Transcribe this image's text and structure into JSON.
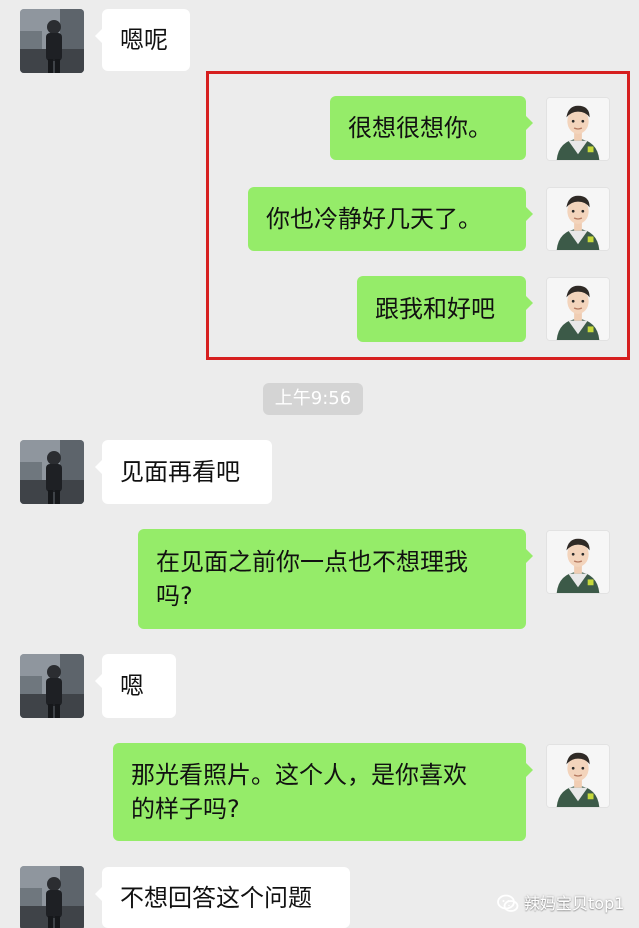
{
  "conversation": {
    "messages": [
      {
        "sender": "contact",
        "text": "嗯呢",
        "avatar": "contact-avatar"
      },
      {
        "sender": "self",
        "text": "很想很想你。",
        "avatar": "self-avatar"
      },
      {
        "sender": "self",
        "text": "你也冷静好几天了。",
        "avatar": "self-avatar"
      },
      {
        "sender": "self",
        "text": "跟我和好吧",
        "avatar": "self-avatar"
      },
      {
        "sender": "system",
        "text": "上午9:56"
      },
      {
        "sender": "contact",
        "text": "见面再看吧",
        "avatar": "contact-avatar"
      },
      {
        "sender": "self",
        "text": "在见面之前你一点也不想理我\n吗?",
        "avatar": "self-avatar"
      },
      {
        "sender": "contact",
        "text": "嗯",
        "avatar": "contact-avatar"
      },
      {
        "sender": "self",
        "text": "那光看照片。这个人，是你喜欢\n的样子吗?",
        "avatar": "self-avatar"
      },
      {
        "sender": "contact",
        "text": "不想回答这个问题",
        "avatar": "contact-avatar"
      }
    ]
  },
  "watermark": {
    "text": "辣妈宝贝top1",
    "icon": "wechat-icon"
  },
  "colors": {
    "background": "#ececec",
    "incoming_bubble": "#ffffff",
    "outgoing_bubble": "#95ec69",
    "highlight_border": "#d61f1f",
    "time_pill": "#d4d4d4"
  }
}
